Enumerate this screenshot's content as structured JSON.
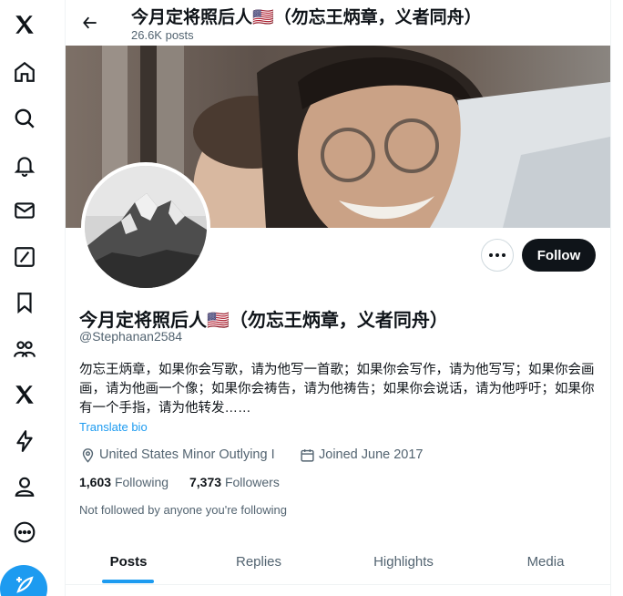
{
  "header": {
    "title": "今月定将照后人🇺🇸（勿忘王炳章，义者同舟）",
    "posts_count": "26.6K posts"
  },
  "profile": {
    "display_name": "今月定将照后人🇺🇸（勿忘王炳章，义者同舟）",
    "handle": "@Stephanan2584",
    "bio": "勿忘王炳章，如果你会写歌，请为他写一首歌；如果你会写作，请为他写写；如果你会画画，请为他画一个像；如果你会祷告，请为他祷告；如果你会说话，请为他呼吁；如果你有一个手指，请为他转发……",
    "translate_label": "Translate bio",
    "location": "United States Minor Outlying I",
    "joined": "Joined June 2017",
    "following_count": "1,603",
    "following_label": "Following",
    "followers_count": "7,373",
    "followers_label": "Followers",
    "not_followed": "Not followed by anyone you're following"
  },
  "actions": {
    "follow_label": "Follow"
  },
  "tabs": [
    {
      "label": "Posts",
      "active": true
    },
    {
      "label": "Replies",
      "active": false
    },
    {
      "label": "Highlights",
      "active": false
    },
    {
      "label": "Media",
      "active": false
    }
  ],
  "nav": {
    "icons": [
      "x-logo-icon",
      "home-icon",
      "search-icon",
      "bell-icon",
      "mail-icon",
      "grok-icon",
      "bookmark-icon",
      "communities-icon",
      "x-premium-icon",
      "lightning-icon",
      "profile-icon",
      "more-circle-icon",
      "compose-icon"
    ]
  },
  "colors": {
    "accent": "#1d9bf0",
    "text": "#0f1419",
    "secondary": "#536471",
    "follow_bg": "#0f1419"
  }
}
